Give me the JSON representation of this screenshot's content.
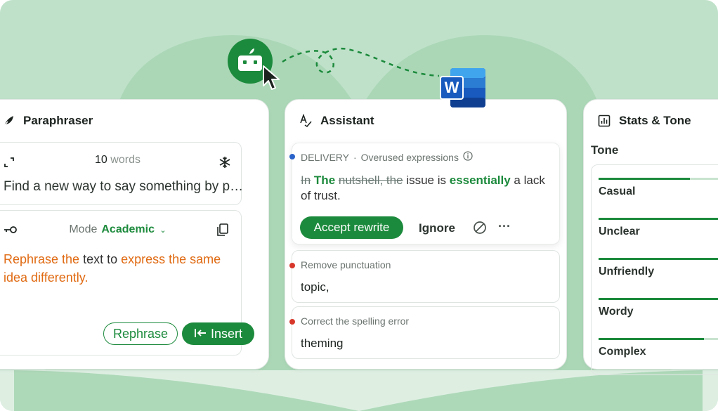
{
  "paraphraser": {
    "title": "Paraphraser",
    "word_count_num": "10",
    "word_count_unit": "words",
    "input_text": "Find a new way to say something by pa...",
    "mode_label": "Mode",
    "mode_value": "Academic",
    "output_parts": {
      "p1": "Rephrase the",
      "p2": " text to ",
      "p3": "express the same idea differently."
    },
    "rephrase_label": "Rephrase",
    "insert_label": "Insert"
  },
  "assistant": {
    "title": "Assistant",
    "main": {
      "category": "DELIVERY",
      "separator": "·",
      "issue": "Overused expressions",
      "strike1": "In",
      "ins1": "The",
      "strike2": "nutshell, the",
      "text1": "issue is",
      "ins2": "essentially",
      "text2": "a lack of trust.",
      "accept_label": "Accept rewrite",
      "ignore_label": "Ignore"
    },
    "punct": {
      "label": "Remove punctuation",
      "value": "topic,"
    },
    "spell": {
      "label": "Correct the spelling error",
      "value": "theming"
    }
  },
  "stats": {
    "title": "Stats & Tone",
    "tone_title": "Tone",
    "tones": [
      {
        "label": "Casual",
        "level": 0.65
      },
      {
        "label": "Unclear",
        "level": 1.0
      },
      {
        "label": "Unfriendly",
        "level": 1.0
      },
      {
        "label": "Wordy",
        "level": 1.0
      },
      {
        "label": "Complex",
        "level": 0.75
      }
    ]
  },
  "colors": {
    "accent": "#1c8a3c",
    "highlight": "#e06a12",
    "background": "#bfe1c9"
  },
  "icons": [
    "feather-icon",
    "expand-icon",
    "snowflake-icon",
    "key-icon",
    "copy-icon",
    "spellcheck-icon",
    "info-icon",
    "block-icon",
    "more-icon",
    "stats-icon",
    "bot-logo",
    "cursor-icon",
    "word-logo"
  ]
}
